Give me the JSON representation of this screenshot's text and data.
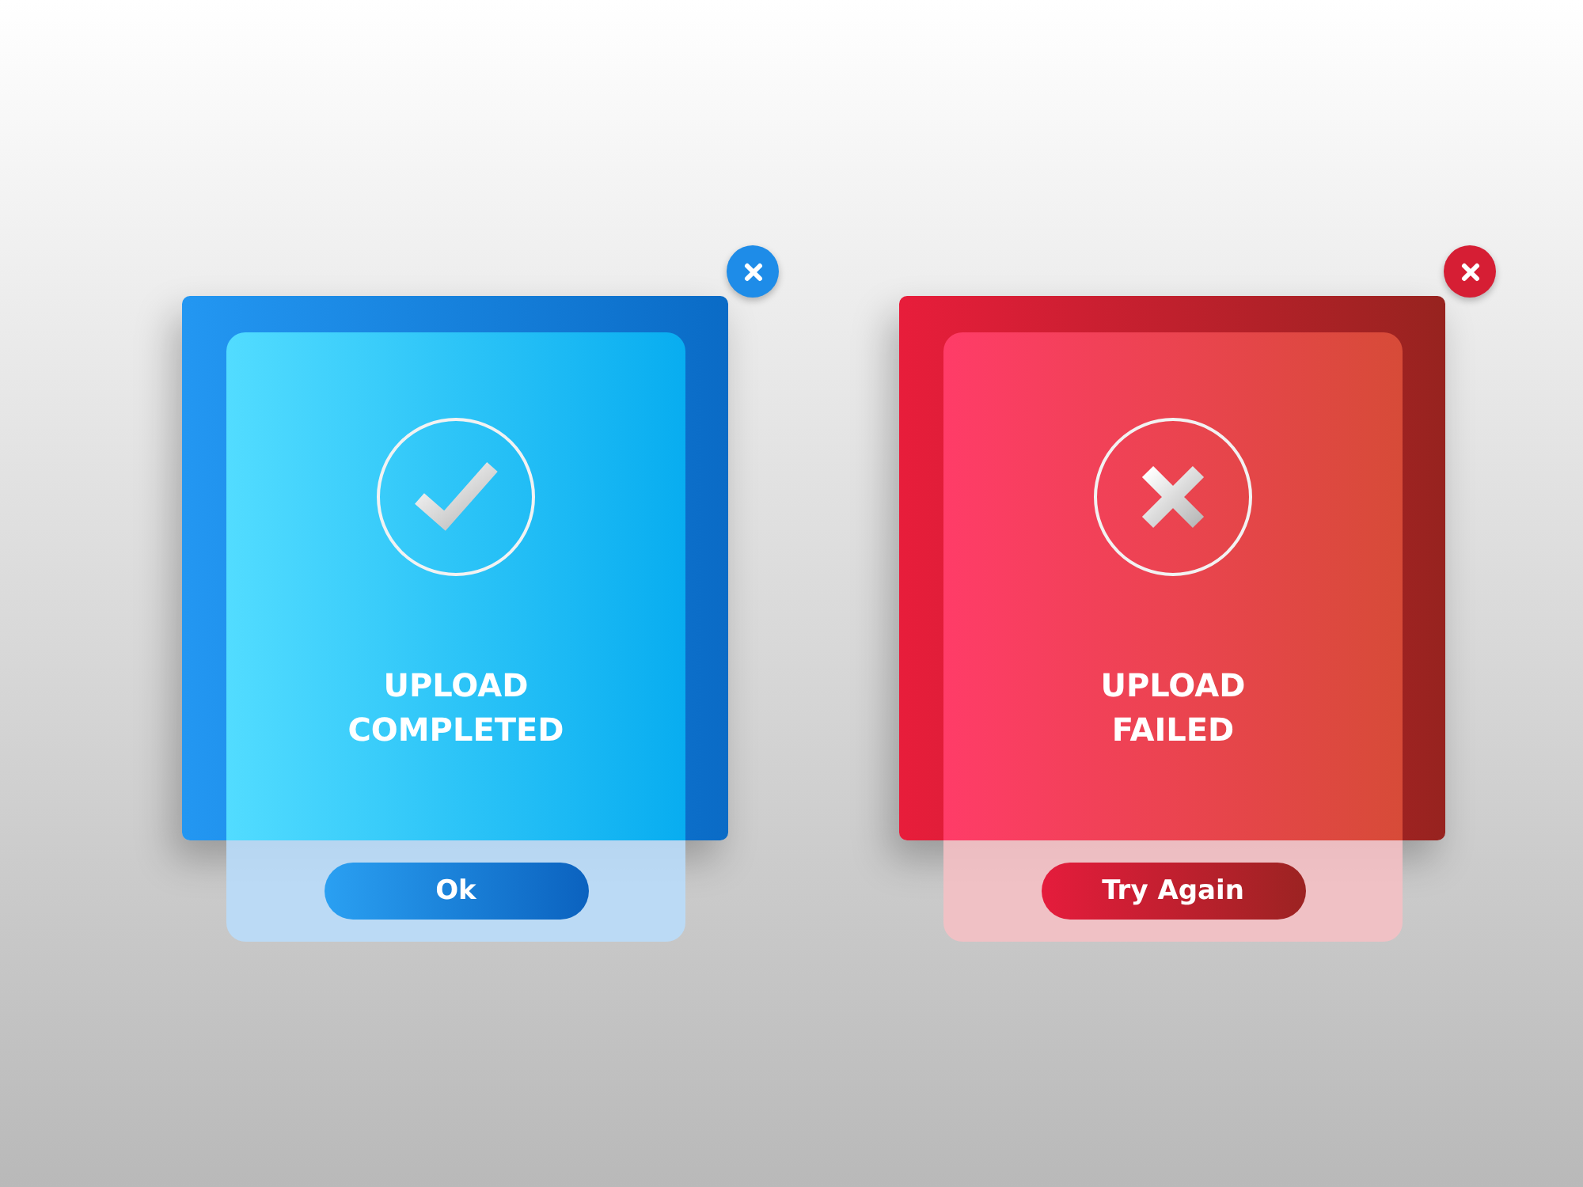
{
  "dialogs": [
    {
      "kind": "success",
      "title": "UPLOAD COMPLETED",
      "button": "Ok"
    },
    {
      "kind": "failure",
      "title": "UPLOAD FAILED",
      "button": "Try Again"
    }
  ]
}
